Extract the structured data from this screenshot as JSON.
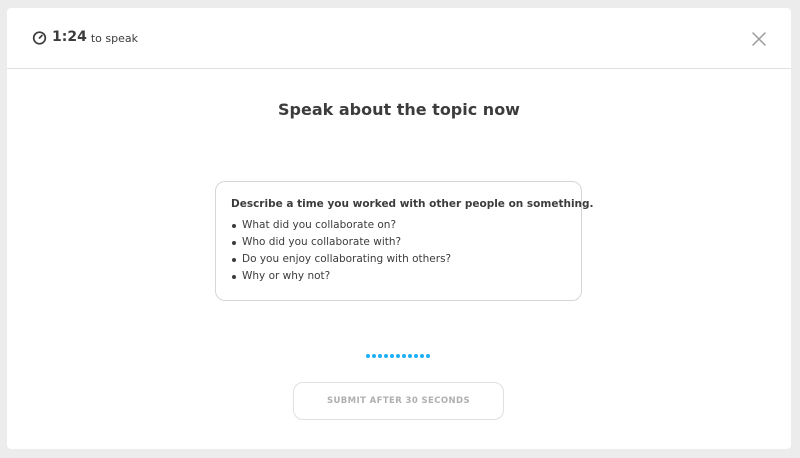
{
  "header": {
    "timer_value": "1:24",
    "timer_suffix": "to speak",
    "timer_icon": "stopwatch-icon",
    "close_icon": "close-icon"
  },
  "title": "Speak about the topic now",
  "prompt": {
    "heading": "Describe a time you worked with other people on something.",
    "items": [
      "What did you collaborate on?",
      "Who did you collaborate with?",
      "Do you enjoy collaborating with others?",
      "Why or why not?"
    ]
  },
  "audio_meter": {
    "dot_count": 11,
    "color": "#1cb0f6"
  },
  "submit": {
    "label": "SUBMIT AFTER 30 SECONDS",
    "disabled": true
  },
  "colors": {
    "text": "#3c3c3c",
    "border": "#e0e0e0",
    "disabled_text": "#afafaf",
    "accent": "#1cb0f6",
    "backdrop": "#ececec"
  }
}
